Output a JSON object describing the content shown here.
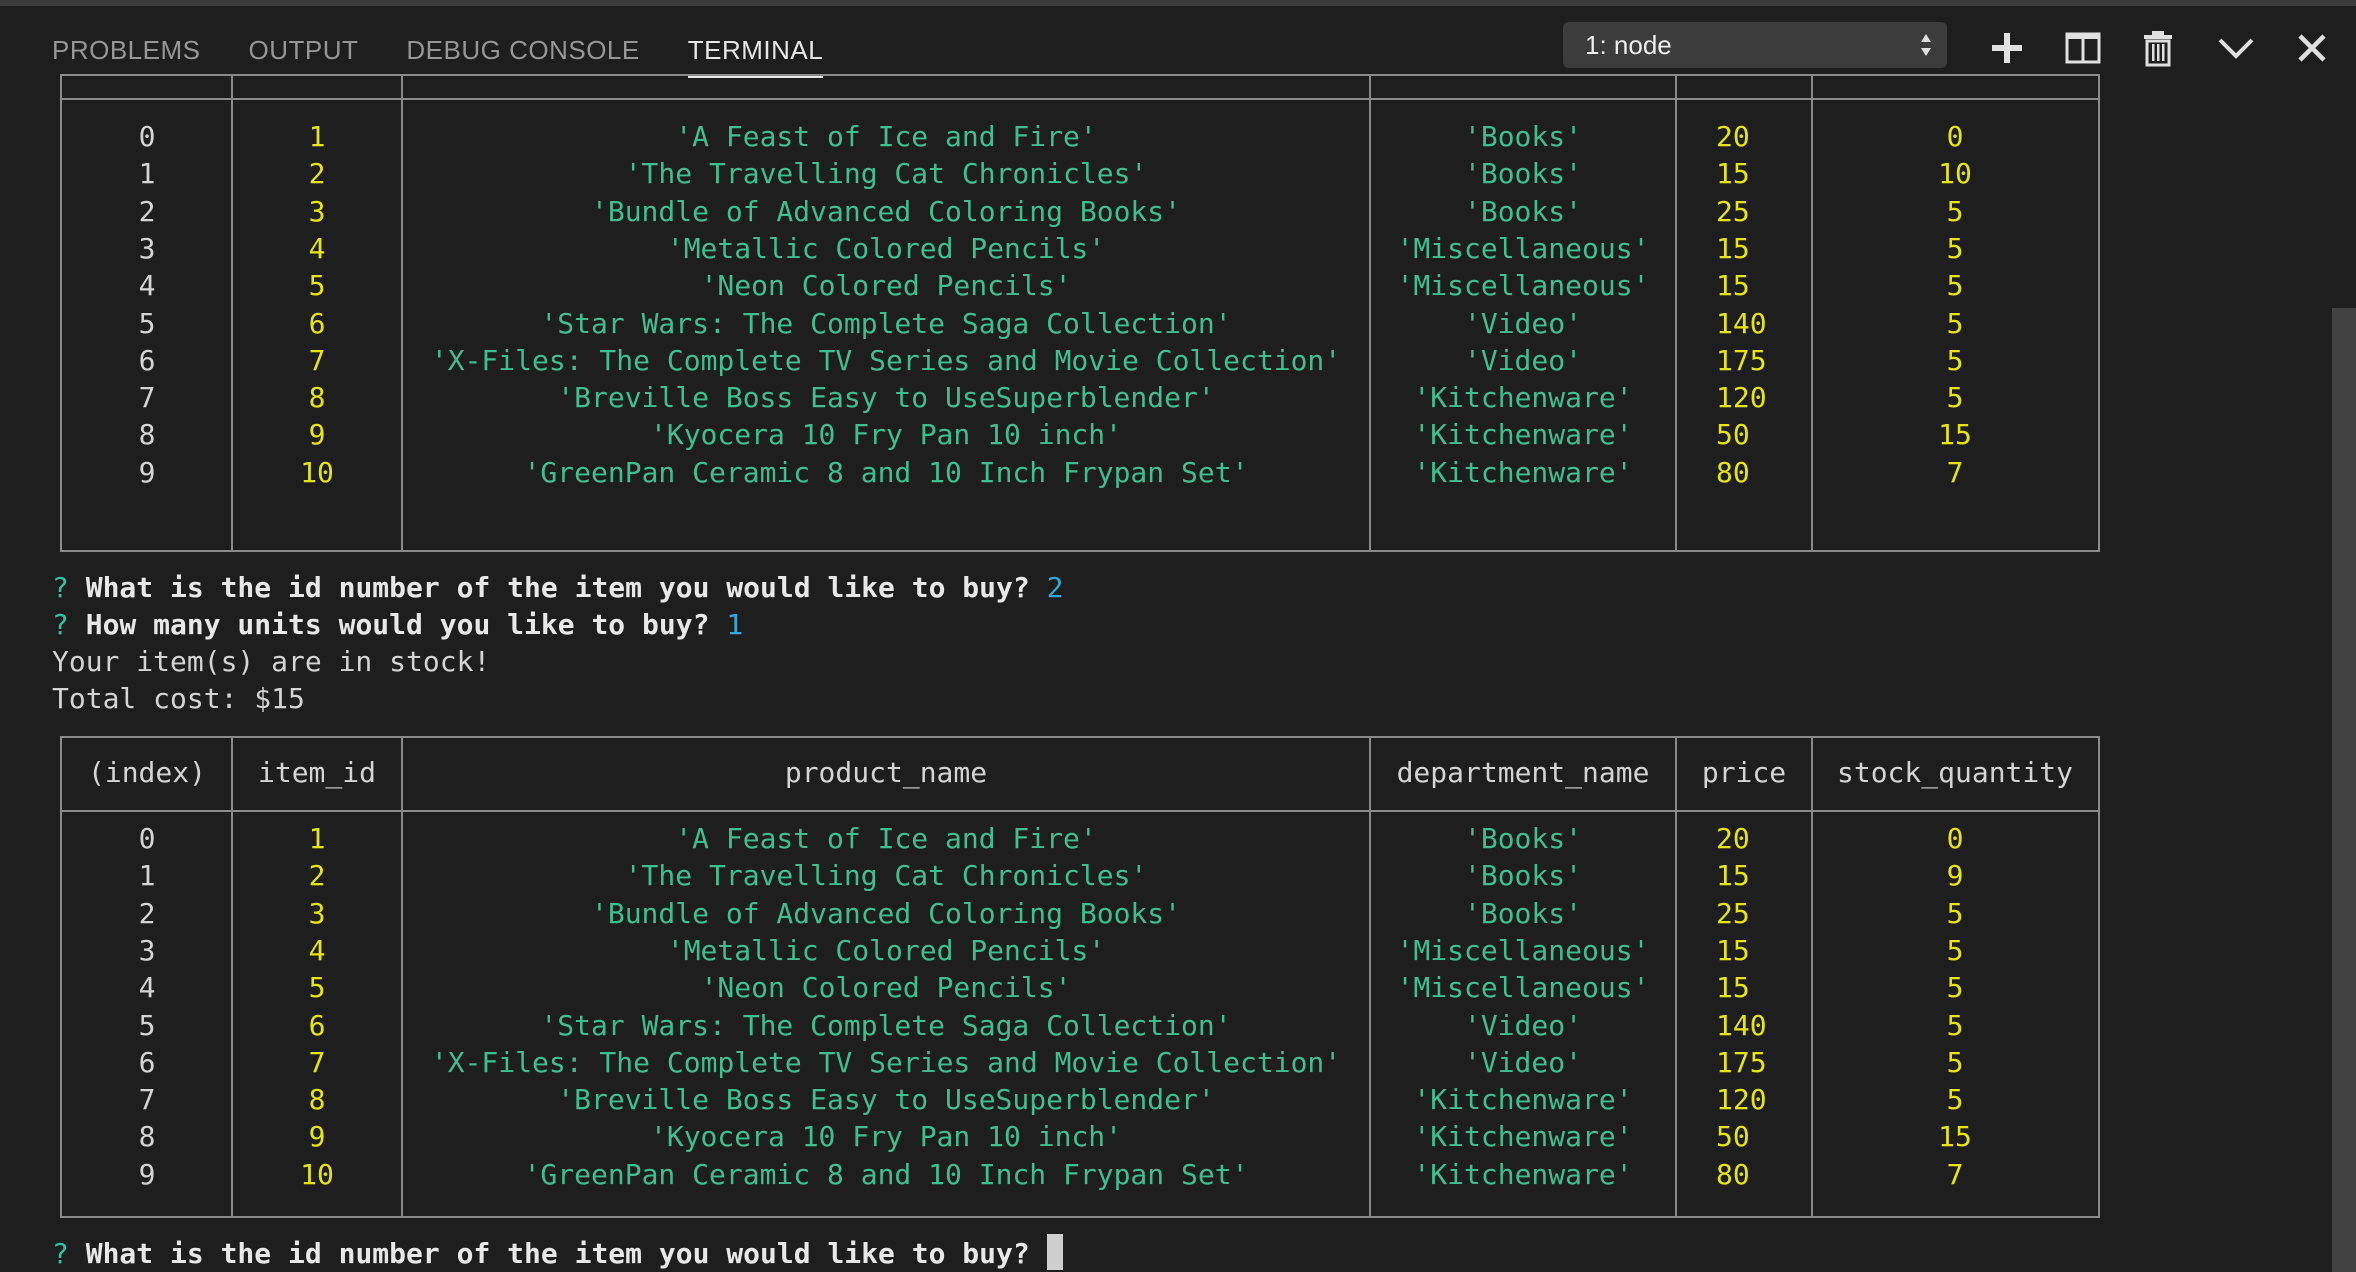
{
  "panel": {
    "tabs": [
      {
        "label": "PROBLEMS",
        "active": false
      },
      {
        "label": "OUTPUT",
        "active": false
      },
      {
        "label": "DEBUG CONSOLE",
        "active": false
      },
      {
        "label": "TERMINAL",
        "active": true
      }
    ],
    "terminal_selector": {
      "value": "1: node"
    },
    "actions": [
      "plus-icon",
      "split-terminal-icon",
      "trash-icon",
      "chevron-down-icon",
      "close-icon"
    ]
  },
  "colors": {
    "background": "#1e1e1e",
    "string": "#3fbf8f",
    "number": "#e5e510",
    "prompt_mark": "#2ec4a0",
    "answer": "#33a6d8"
  },
  "table": {
    "headers": [
      "(index)",
      "item_id",
      "product_name",
      "department_name",
      "price",
      "stock_quantity"
    ],
    "rows_first": [
      [
        "0",
        "1",
        "'A Feast of Ice and Fire'",
        "'Books'",
        "20",
        "0"
      ],
      [
        "1",
        "2",
        "'The Travelling Cat Chronicles'",
        "'Books'",
        "15",
        "10"
      ],
      [
        "2",
        "3",
        "'Bundle of Advanced Coloring Books'",
        "'Books'",
        "25",
        "5"
      ],
      [
        "3",
        "4",
        "'Metallic Colored Pencils'",
        "'Miscellaneous'",
        "15",
        "5"
      ],
      [
        "4",
        "5",
        "'Neon Colored Pencils'",
        "'Miscellaneous'",
        "15",
        "5"
      ],
      [
        "5",
        "6",
        "'Star Wars: The Complete Saga Collection'",
        "'Video'",
        "140",
        "5"
      ],
      [
        "6",
        "7",
        "'X-Files: The Complete TV Series and Movie Collection'",
        "'Video'",
        "175",
        "5"
      ],
      [
        "7",
        "8",
        "'Breville Boss Easy to UseSuperblender'",
        "'Kitchenware'",
        "120",
        "5"
      ],
      [
        "8",
        "9",
        "'Kyocera 10 Fry Pan 10 inch'",
        "'Kitchenware'",
        "50",
        "15"
      ],
      [
        "9",
        "10",
        "'GreenPan Ceramic 8 and 10 Inch Frypan Set'",
        "'Kitchenware'",
        "80",
        "7"
      ]
    ],
    "rows_second": [
      [
        "0",
        "1",
        "'A Feast of Ice and Fire'",
        "'Books'",
        "20",
        "0"
      ],
      [
        "1",
        "2",
        "'The Travelling Cat Chronicles'",
        "'Books'",
        "15",
        "9"
      ],
      [
        "2",
        "3",
        "'Bundle of Advanced Coloring Books'",
        "'Books'",
        "25",
        "5"
      ],
      [
        "3",
        "4",
        "'Metallic Colored Pencils'",
        "'Miscellaneous'",
        "15",
        "5"
      ],
      [
        "4",
        "5",
        "'Neon Colored Pencils'",
        "'Miscellaneous'",
        "15",
        "5"
      ],
      [
        "5",
        "6",
        "'Star Wars: The Complete Saga Collection'",
        "'Video'",
        "140",
        "5"
      ],
      [
        "6",
        "7",
        "'X-Files: The Complete TV Series and Movie Collection'",
        "'Video'",
        "175",
        "5"
      ],
      [
        "7",
        "8",
        "'Breville Boss Easy to UseSuperblender'",
        "'Kitchenware'",
        "120",
        "5"
      ],
      [
        "8",
        "9",
        "'Kyocera 10 Fry Pan 10 inch'",
        "'Kitchenware'",
        "50",
        "15"
      ],
      [
        "9",
        "10",
        "'GreenPan Ceramic 8 and 10 Inch Frypan Set'",
        "'Kitchenware'",
        "80",
        "7"
      ]
    ]
  },
  "session": {
    "prompt_mark": "?",
    "q1": "What is the id number of the item you would like to buy?",
    "a1": "2",
    "q2": "How many units would you like to buy?",
    "a2": "1",
    "msg_stock": "Your item(s) are in stock!",
    "msg_total": "Total cost: $15",
    "q3": "What is the id number of the item you would like to buy?"
  }
}
